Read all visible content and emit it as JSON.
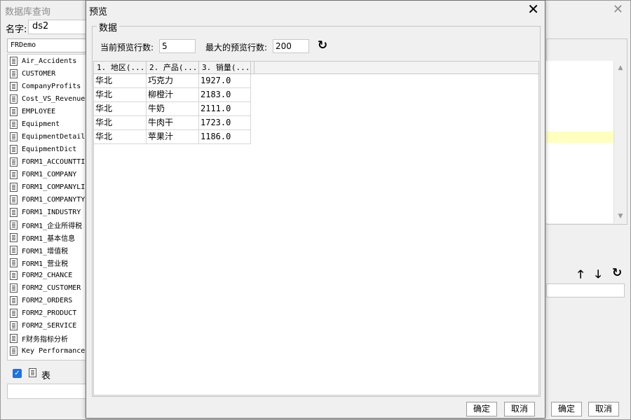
{
  "background_window": {
    "title": "数据库查询",
    "close_glyph": "✕",
    "name_label": "名字:",
    "name_value": "ds2",
    "database": "FRDemo",
    "tables": [
      "Air_Accidents",
      "CUSTOMER",
      "CompanyProfits",
      "Cost_VS_Revenue",
      "EMPLOYEE",
      "Equipment",
      "EquipmentDetail",
      "EquipmentDict",
      "FORM1_ACCOUNTTI",
      "FORM1_COMPANY",
      "FORM1_COMPANYLI",
      "FORM1_COMPANYTY",
      "FORM1_INDUSTRY",
      "FORM1_企业所得税",
      "FORM1_基本信息",
      "FORM1_增值税",
      "FORM1_营业税",
      "FORM2_CHANCE",
      "FORM2_CUSTOMER",
      "FORM2_ORDERS",
      "FORM2_PRODUCT",
      "FORM2_SERVICE",
      "F财务指标分析",
      "Key Performance"
    ],
    "show_table_checked": true,
    "show_table_label": "表",
    "move_up_glyph": "🡑",
    "move_down_glyph": "🡓",
    "refresh_glyph": "↻",
    "ok_label": "确定",
    "cancel_label": "取消"
  },
  "preview_dialog": {
    "title": "预览",
    "close_glyph": "✕",
    "group_label": "数据",
    "current_rows_label": "当前预览行数:",
    "current_rows_value": "5",
    "max_rows_label": "最大的预览行数:",
    "max_rows_value": "200",
    "refresh_glyph": "↻",
    "columns": [
      "1. 地区(...",
      "2. 产品(...",
      "3. 销量(..."
    ],
    "rows": [
      [
        "华北",
        "巧克力",
        "1927.0"
      ],
      [
        "华北",
        "柳橙汁",
        "2183.0"
      ],
      [
        "华北",
        "牛奶",
        "2111.0"
      ],
      [
        "华北",
        "牛肉干",
        "1723.0"
      ],
      [
        "华北",
        "苹果汁",
        "1186.0"
      ]
    ],
    "ok_label": "确定",
    "cancel_label": "取消"
  }
}
